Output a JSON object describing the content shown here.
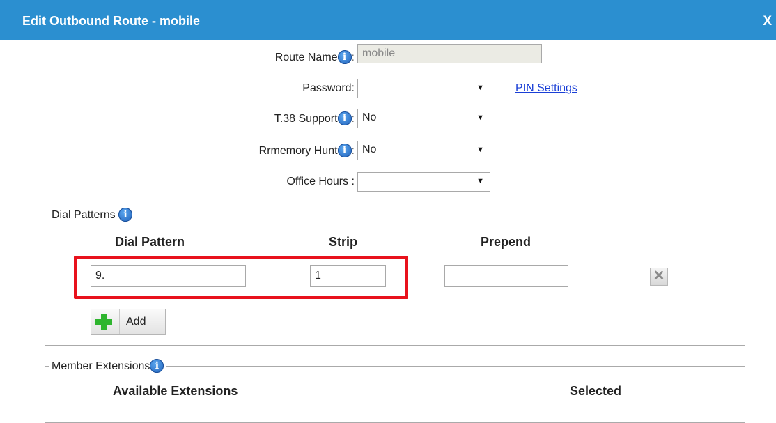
{
  "dialog": {
    "title": "Edit Outbound Route - mobile",
    "close_label": "X"
  },
  "form": {
    "route_name": {
      "label": "Route Name",
      "colon": ":",
      "value": "mobile"
    },
    "password": {
      "label": "Password:",
      "value": ""
    },
    "pin_settings_link": "PIN Settings",
    "t38": {
      "label": "T.38 Support",
      "colon": ":",
      "value": "No"
    },
    "rrmemory": {
      "label": "Rrmemory Hunt",
      "colon": ":",
      "value": "No"
    },
    "office_hours": {
      "label": "Office Hours :",
      "value": ""
    }
  },
  "dial_patterns": {
    "legend": "Dial Patterns",
    "headers": {
      "pattern": "Dial Pattern",
      "strip": "Strip",
      "prepend": "Prepend"
    },
    "row": {
      "pattern": "9.",
      "strip": "1",
      "prepend": ""
    },
    "add_label": "Add"
  },
  "member_extensions": {
    "legend": "Member Extensions",
    "headers": {
      "available": "Available Extensions",
      "selected": "Selected"
    }
  },
  "icons": {
    "info": "info-icon",
    "delete": "delete-x-icon",
    "add": "plus-icon",
    "dropdown": "dropdown-arrow-icon"
  },
  "colors": {
    "title_bar": "#2b8fd0",
    "highlight": "#e8121c",
    "link": "#1a3fd6",
    "add_plus": "#2fb52f"
  }
}
